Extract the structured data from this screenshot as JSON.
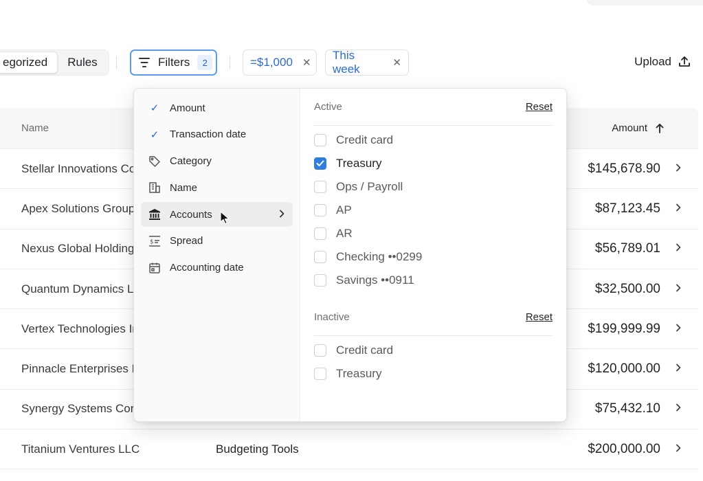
{
  "toolbar": {
    "seg_categorized": "egorized",
    "seg_rules": "Rules",
    "filters_label": "Filters",
    "filters_count": "2",
    "chip_amount": "=$1,000",
    "chip_date": "This week",
    "upload_label": "Upload"
  },
  "table": {
    "col_name": "Name",
    "col_amount": "Amount",
    "rows": [
      {
        "name": "Stellar Innovations Cor",
        "category": "",
        "amount": "$145,678.90"
      },
      {
        "name": "Apex Solutions Group",
        "category": "",
        "amount": "$87,123.45"
      },
      {
        "name": "Nexus Global Holdings",
        "category": "",
        "amount": "$56,789.01"
      },
      {
        "name": "Quantum Dynamics LL",
        "category": "",
        "amount": "$32,500.00"
      },
      {
        "name": "Vertex Technologies In",
        "category": "",
        "amount": "$199,999.99"
      },
      {
        "name": "Pinnacle Enterprises Lt",
        "category": "",
        "amount": "$120,000.00"
      },
      {
        "name": "Synergy Systems Corp",
        "category": "",
        "amount": "$75,432.10"
      },
      {
        "name": "Titanium Ventures LLC",
        "category": "Budgeting Tools",
        "amount": "$200,000.00"
      }
    ]
  },
  "filter_menu": {
    "items": [
      {
        "label": "Amount",
        "icon": "check-icon"
      },
      {
        "label": "Transaction date",
        "icon": "check-icon"
      },
      {
        "label": "Category",
        "icon": "tag-icon"
      },
      {
        "label": "Name",
        "icon": "building-icon"
      },
      {
        "label": "Accounts",
        "icon": "bank-icon"
      },
      {
        "label": "Spread",
        "icon": "spread-icon"
      },
      {
        "label": "Accounting date",
        "icon": "calendar-icon"
      }
    ]
  },
  "accounts_panel": {
    "active_label": "Active",
    "inactive_label": "Inactive",
    "reset_label": "Reset",
    "active_options": [
      {
        "label": "Credit card",
        "checked": false
      },
      {
        "label": "Treasury",
        "checked": true
      },
      {
        "label": "Ops / Payroll",
        "checked": false
      },
      {
        "label": "AP",
        "checked": false
      },
      {
        "label": "AR",
        "checked": false
      },
      {
        "label": "Checking ••0299",
        "checked": false
      },
      {
        "label": "Savings ••0911",
        "checked": false
      }
    ],
    "inactive_options": [
      {
        "label": "Credit card",
        "checked": false
      },
      {
        "label": "Treasury",
        "checked": false
      }
    ]
  },
  "colors": {
    "accent": "#2f7de1",
    "chip_text": "#2a6cc8",
    "focus_border": "#5b9bf0"
  }
}
